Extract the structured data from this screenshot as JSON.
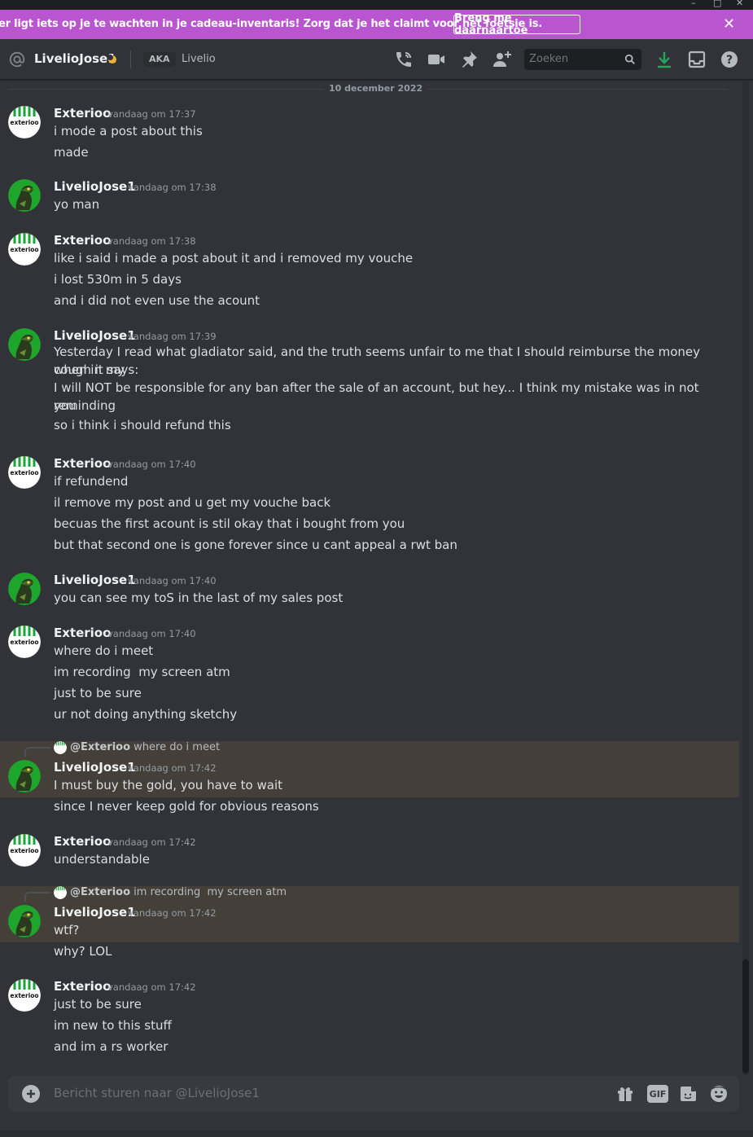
{
  "window": {
    "minimize": "–",
    "maximize": "□",
    "close": "✕"
  },
  "banner": {
    "text": "er ligt iets op je te wachten in je cadeau-inventaris! Zorg dat je het claimt voor het foetsie is.",
    "button": "Breng me daarnaartoe",
    "close": "✕",
    "color": "#b956cf"
  },
  "header": {
    "username": "LivelioJose1",
    "aka_label": "AKA",
    "aka_name": "Livelio",
    "search_placeholder": "Zoeken",
    "icons": [
      "voice-call-icon",
      "video-call-icon",
      "pin-icon",
      "add-friend-icon",
      "search-icon",
      "download-icon",
      "inbox-icon",
      "help-icon"
    ]
  },
  "chat": {
    "date": "10 december 2022",
    "messages": [
      {
        "author": "Exterioo",
        "time": "vandaag om 17:37",
        "lines": [
          "i mode a post about this",
          "made"
        ]
      },
      {
        "author": "LivelioJose1",
        "time": "vandaag om 17:38",
        "lines": [
          "yo man"
        ]
      },
      {
        "author": "Exterioo",
        "time": "vandaag om 17:38",
        "lines": [
          "like i said i made a post about it and i removed my vouche",
          "i lost 530m in 5 days",
          "and i did not even use the acount"
        ]
      },
      {
        "author": "LivelioJose1",
        "time": "vandaag om 17:39",
        "lines": [
          "Yesterday I read what gladiator said, and the truth seems unfair to me that I should reimburse the money when in my",
          "cough it says:",
          "I will NOT be responsible for any ban after the sale of an account, but hey... I think my mistake was in not reminding",
          "you",
          "so i think i should refund this"
        ]
      },
      {
        "author": "Exterioo",
        "time": "vandaag om 17:40",
        "lines": [
          "if refundend",
          "il remove my post and u get my vouche back",
          "becuas the first acount is stil okay that i bought from you",
          "but that second one is gone forever since u cant appeal a rwt ban"
        ]
      },
      {
        "author": "LivelioJose1",
        "time": "vandaag om 17:40",
        "lines": [
          "you can see my toS in the last of my sales post"
        ]
      },
      {
        "author": "Exterioo",
        "time": "vandaag om 17:40",
        "lines": [
          "where do i meet",
          "im recording  my screen atm",
          "just to be sure",
          "ur not doing anything sketchy"
        ]
      },
      {
        "author": "LivelioJose1",
        "time": "vandaag om 17:42",
        "reply_author": "@Exterioo",
        "reply_text": "where do i meet",
        "lines": [
          "I must buy the gold, you have to wait",
          "since I never keep gold for obvious reasons"
        ]
      },
      {
        "author": "Exterioo",
        "time": "vandaag om 17:42",
        "lines": [
          "understandable"
        ]
      },
      {
        "author": "LivelioJose1",
        "time": "vandaag om 17:42",
        "reply_author": "@Exterioo",
        "reply_text": "im recording  my screen atm",
        "lines": [
          "wtf?",
          "why? LOL"
        ]
      },
      {
        "author": "Exterioo",
        "time": "vandaag om 17:42",
        "lines": [
          "just to be sure",
          "im new to this stuff",
          "and im a rs worker"
        ]
      }
    ]
  },
  "composer": {
    "placeholder": "Bericht sturen naar @LivelioJose1",
    "icons": [
      "plus-icon",
      "gift-icon",
      "gif-icon",
      "sticker-icon",
      "emoji-icon"
    ],
    "gif_label": "GIF"
  },
  "avatars": {
    "exterioo_text": "exterioo"
  },
  "colors": {
    "background": "#313338",
    "highlight": "#444039",
    "accent_green": "#23a55a",
    "avatar_green": "#1ba339"
  }
}
